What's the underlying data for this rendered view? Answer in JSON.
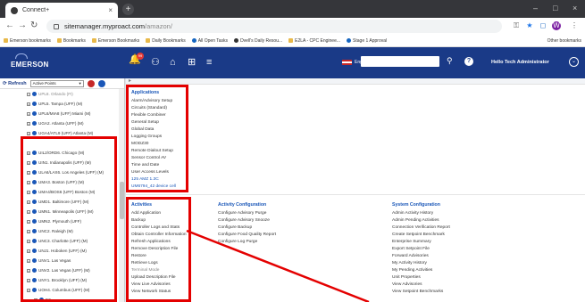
{
  "browser": {
    "tab_title": "Connect+",
    "new_tab_icon": "plus-icon",
    "window_controls": [
      "–",
      "□",
      "×"
    ],
    "url_host": "sitemanager.myproact.com",
    "url_path": "/amazon/"
  },
  "bookmarks": [
    {
      "label": "Emerson bookmarks",
      "icon": "folder-icon",
      "kind": "folder"
    },
    {
      "label": "Bookmarks",
      "icon": "star-icon",
      "kind": "star"
    },
    {
      "label": "Emerson Bookmarks",
      "icon": "folder-icon",
      "kind": "folder"
    },
    {
      "label": "Daily Bookmarks",
      "icon": "folder-icon",
      "kind": "folder"
    },
    {
      "label": "All Open Tasks",
      "icon": "cp-icon",
      "kind": "blue"
    },
    {
      "label": "Dvell's Daily Resou...",
      "icon": "globe-icon",
      "kind": "dark"
    },
    {
      "label": "E2LA - CPC Enginee...",
      "icon": "page-icon",
      "kind": "folder"
    },
    {
      "label": "Stage 1 Approval",
      "icon": "cp-icon",
      "kind": "blue"
    }
  ],
  "bookmarks_other": "Other bookmarks",
  "header": {
    "logo": "EMERSON",
    "alarm_count": "99",
    "lang_label": "English",
    "greeting": "Hello  Tech Administrator"
  },
  "sidebar": {
    "refresh_label": "Refresh",
    "filter_value": "Active Points",
    "nodes": [
      {
        "label": "UPL8. Orlando (FI)",
        "level": 0,
        "dim": true
      },
      {
        "label": "UPL5. Tampa (UFF) (M)",
        "level": 0
      },
      {
        "label": "UPL6/MIA8 (UFF) Miami (M)",
        "level": 0
      },
      {
        "label": "UGA2. Atlanta (UFF) (M)",
        "level": 0
      },
      {
        "label": "UGA4/ATL9 (UFF) Atlanta (M)",
        "level": 0
      },
      {
        "label": "",
        "level": -1
      },
      {
        "label": "UIL2/ORD6. Chicago (M)",
        "level": 0
      },
      {
        "label": "UIN1. Indianapolis (UFF) (M)",
        "level": 0
      },
      {
        "label": "ULA6/LAX6. Los Angeles (UFF) (M)",
        "level": 0
      },
      {
        "label": "UMA3. Boston (UFF) (M)",
        "level": 0
      },
      {
        "label": "UMA4/BOS6 (UFF) Boston (M)",
        "level": 0
      },
      {
        "label": "UMD1. Baltimore (UFF) (M)",
        "level": 0
      },
      {
        "label": "UMN1. Minneapolis (UFF) (M)",
        "level": 0
      },
      {
        "label": "UMN2. Plymouth (UFF)",
        "level": 0
      },
      {
        "label": "UNC2. Raleigh (M)",
        "level": 0
      },
      {
        "label": "UNC3. Charlotte (UFF) (M)",
        "level": 0
      },
      {
        "label": "UNJ1. Hoboken (UFF) (M)",
        "level": 0
      },
      {
        "label": "UNV1. Las Vegas",
        "level": 0
      },
      {
        "label": "UNV2. Las Vegas (UFF) (M)",
        "level": 0
      },
      {
        "label": "UNY1. Brooklyn (UFF) (M)",
        "level": 0
      },
      {
        "label": "UOH4. Columbus (UFF) (M)",
        "level": 0
      },
      {
        "label": "E3",
        "level": 1
      },
      {
        "label": "CS-400 1: UFF UOH4",
        "level": 2
      }
    ]
  },
  "menus": {
    "applications": {
      "title": "Applications",
      "items": [
        "Alarm/Advisory Setup",
        "Circuits (Standard)",
        "Flexible Combiner",
        "General Setup",
        "Global Data",
        "Logging Groups",
        "MODZ30",
        "Remote Dialout Setup",
        "Sensor Control AV",
        "Time and Date",
        "User Access Levels",
        "125 AMZ 1.3C",
        "UM6794_42 device cell"
      ]
    },
    "activities": {
      "title": "Activities",
      "items": [
        "Add Application",
        "Backup",
        "Controller Logs and Stats",
        "Obtain Controller Information",
        "Refresh Applications",
        "Remove Description File",
        "Restore",
        "Retrieve Logs",
        "Terminal Mode",
        "Upload Description File",
        "View Live Advisories",
        "View Network Status"
      ]
    },
    "activity_config": {
      "title": "Activity Configuration",
      "items": [
        "Configure Advisory Purge",
        "Configure Advisory Snooze",
        "Configure Backup",
        "Configure Food Quality Report",
        "Configure Log Purge"
      ]
    },
    "system_config": {
      "title": "System Configuration",
      "items": [
        "Admin Activity History",
        "Admin Pending Activities",
        "Connection Verification Report",
        "Create Setpoint Benchmark",
        "Enterprise Summary",
        "Export Setpoint File",
        "Forward Advisories",
        "My Activity History",
        "My Pending Activities",
        "Unit Properties",
        "View Advisories",
        "View Setpoint Benchmarks"
      ]
    }
  },
  "colors": {
    "brand_blue": "#1a3a87",
    "link_blue": "#1a57b8",
    "highlight_red": "#e40000"
  }
}
